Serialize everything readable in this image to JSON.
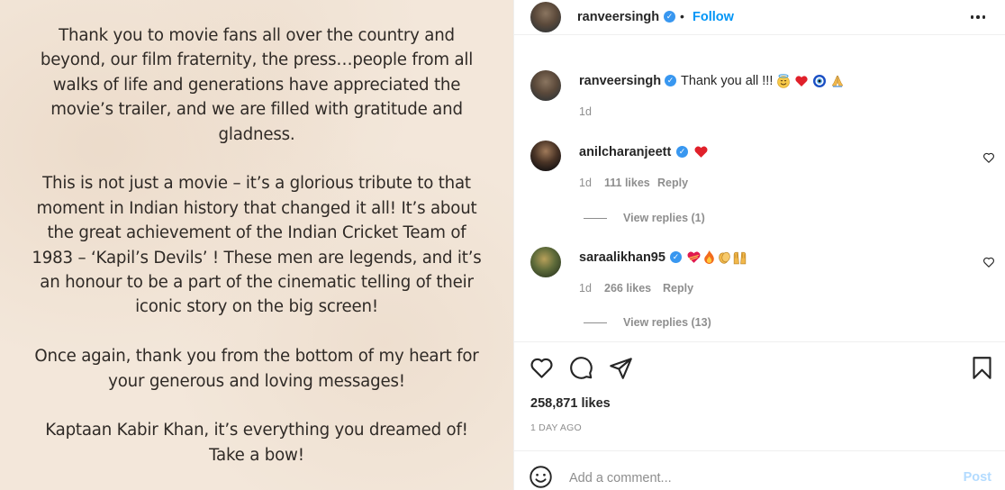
{
  "post_image": {
    "paragraphs": [
      [
        "Thank you to movie fans all over the country and",
        "beyond, our film fraternity, the press…people from all",
        "walks of life and generations have appreciated the",
        "movie’s trailer, and we are filled with gratitude and",
        "gladness."
      ],
      [
        "This is not just a movie – it’s a glorious tribute to that",
        "moment in Indian history that changed it all! It’s about",
        "the great achievement of the Indian Cricket Team of",
        "1983 – ‘Kapil’s Devils’ ! These men are legends, and it’s",
        "an honour to be a part of the cinematic telling of their",
        "iconic story on the big screen!"
      ],
      [
        "Once again, thank you from the bottom of my heart for",
        "your generous and loving messages!"
      ],
      [
        "Kaptaan Kabir Khan, it’s everything you dreamed of!",
        "Take a bow!"
      ]
    ]
  },
  "header": {
    "username": "ranveersingh",
    "separator": "•",
    "follow_label": "Follow"
  },
  "caption": {
    "username": "ranveersingh",
    "text": "Thank you all !!!",
    "emojis": [
      "smiling-halo-emoji",
      "red-heart-emoji",
      "nazar-amulet-emoji",
      "folded-hands-emoji"
    ],
    "age": "1d"
  },
  "comments": [
    {
      "username": "anilcharanjeett",
      "emojis": [
        "red-heart-emoji"
      ],
      "age": "1d",
      "likes": "111 likes",
      "reply_label": "Reply",
      "view_replies": "View replies (1)"
    },
    {
      "username": "saraalikhan95",
      "emojis": [
        "heart-ribbon-emoji",
        "fire-emoji",
        "clapping-hands-emoji",
        "raised-hands-emoji"
      ],
      "age": "1d",
      "likes": "266 likes",
      "reply_label": "Reply",
      "view_replies": "View replies (13)"
    }
  ],
  "actions": {
    "likes": "258,871 likes",
    "timestamp": "1 DAY AGO"
  },
  "composer": {
    "placeholder": "Add a comment...",
    "post_label": "Post"
  },
  "colors": {
    "accent": "#0095f6",
    "verified": "#3897f0",
    "muted": "#8e8e8e",
    "post_disabled": "#b3dbff",
    "image_bg": "#f3e7da"
  }
}
